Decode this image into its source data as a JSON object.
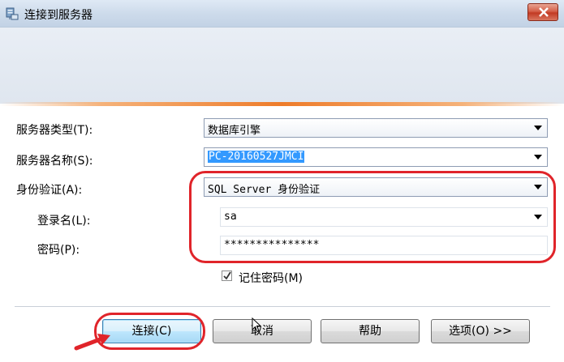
{
  "window": {
    "title": "连接到服务器"
  },
  "form": {
    "server_type": {
      "label": "服务器类型(T):",
      "value": "数据库引擎"
    },
    "server_name": {
      "label": "服务器名称(S):",
      "value": "PC-20160527JMCI"
    },
    "auth": {
      "label": "身份验证(A):",
      "value": "SQL Server 身份验证"
    },
    "login": {
      "label": "登录名(L):",
      "value": "sa"
    },
    "password": {
      "label": "密码(P):",
      "value": "***************"
    },
    "remember": {
      "label": "记住密码(M)",
      "checked": true
    }
  },
  "buttons": {
    "connect": "连接(C)",
    "cancel": "取消",
    "help": "帮助",
    "options": "选项(O) >>"
  },
  "annotation": {
    "color": "#e0242a"
  },
  "accent": {
    "banner_line": "#ee7c2a",
    "close_button": "#c23a23"
  }
}
